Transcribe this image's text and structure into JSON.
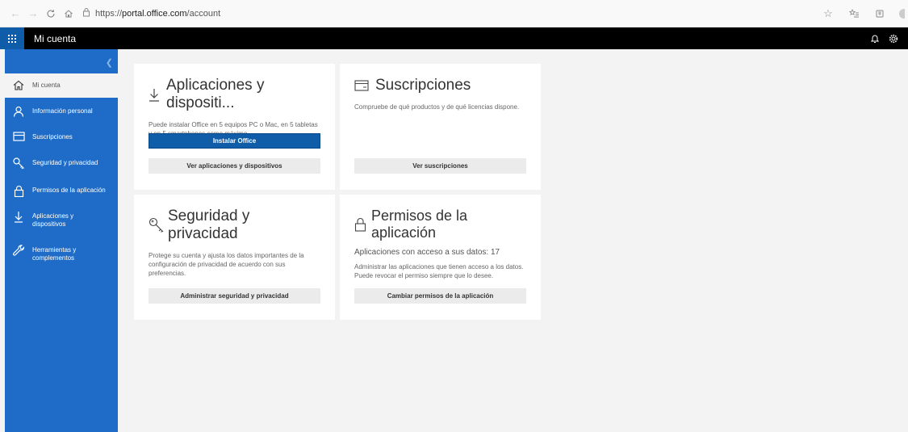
{
  "browser": {
    "url_prefix": "https://",
    "url_host": "portal.office.com",
    "url_path": "/account"
  },
  "header": {
    "title": "Mi cuenta"
  },
  "sidebar": {
    "items": [
      {
        "label": "Mi cuenta",
        "icon": "home-icon"
      },
      {
        "label": "Información personal",
        "icon": "person-icon"
      },
      {
        "label": "Suscripciones",
        "icon": "card-icon"
      },
      {
        "label": "Seguridad y privacidad",
        "icon": "key-icon"
      },
      {
        "label": "Permisos de la aplicación",
        "icon": "lock-icon"
      },
      {
        "label": "Aplicaciones y dispositivos",
        "icon": "download-icon"
      },
      {
        "label": "Herramientas y complementos",
        "icon": "wrench-icon"
      }
    ]
  },
  "cards": {
    "apps": {
      "title": "Aplicaciones y dispositi...",
      "description": "Puede instalar Office en 5 equipos PC o Mac, en 5 tabletas y en 5 smartphones como máximo.",
      "primary_button": "Instalar Office",
      "secondary_button": "Ver aplicaciones y dispositivos"
    },
    "subscriptions": {
      "title": "Suscripciones",
      "description": "Compruebe de qué productos y de qué licencias dispone.",
      "secondary_button": "Ver suscripciones"
    },
    "security": {
      "title": "Seguridad y privacidad",
      "description": "Protege su cuenta y ajusta los datos importantes de la configuración de privacidad de acuerdo con sus preferencias.",
      "secondary_button": "Administrar seguridad y privacidad"
    },
    "permissions": {
      "title": "Permisos de la aplicación",
      "subtitle": "Aplicaciones con acceso a sus datos: 17",
      "description": "Administrar las aplicaciones que tienen acceso a los datos. Puede revocar el permiso siempre que lo desee.",
      "secondary_button": "Cambiar permisos de la aplicación"
    }
  },
  "colors": {
    "accent": "#0f5ca8",
    "sidebar": "#1e6cc7",
    "header": "#000000"
  }
}
